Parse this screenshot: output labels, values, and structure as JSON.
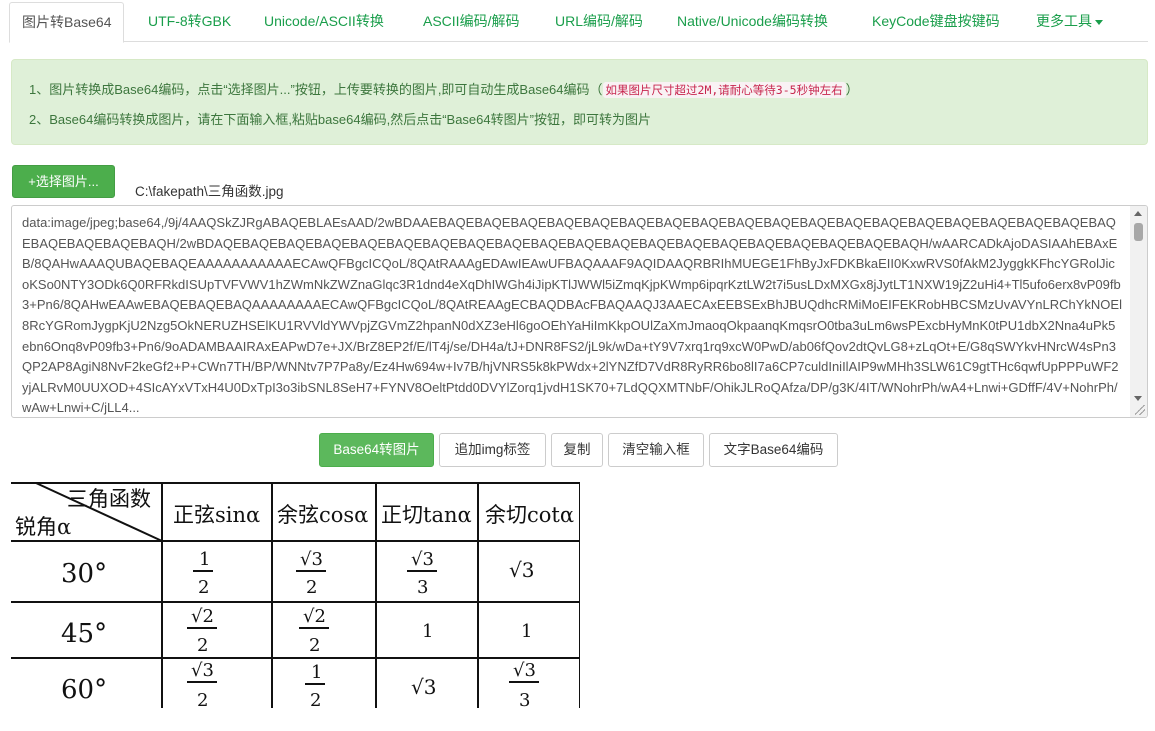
{
  "tabs": [
    {
      "label": "图片转Base64",
      "active": true
    },
    {
      "label": "UTF-8转GBK"
    },
    {
      "label": "Unicode/ASCII转换"
    },
    {
      "label": "ASCII编码/解码"
    },
    {
      "label": "URL编码/解码"
    },
    {
      "label": "Native/Unicode编码转换"
    },
    {
      "label": "KeyCode键盘按键码"
    },
    {
      "label": "更多工具"
    }
  ],
  "info": {
    "line1_main": "1、图片转换成Base64编码，点击“选择图片...”按钮，上传要转换的图片,即可自动生成Base64编码（",
    "line1_highlight": "如果图片尺寸超过2M,请耐心等待3-5秒钟左右",
    "line1_end": "）",
    "line2": "2、Base64编码转换成图片，请在下面输入框,粘贴base64编码,然后点击“Base64转图片”按钮，即可转为图片"
  },
  "select_button": "+选择图片...",
  "file_path": "C:\\fakepath\\三角函数.jpg",
  "textarea_value": "data:image/jpeg;base64,/9j/4AAQSkZJRgABAQEBLAEsAAD/2wBDAAEBAQEBAQEBAQEBAQEBAQEBAQEBAQEBAQEBAQEBAQEBAQEBAQEBAQEBAQEBAQEBAQEBAQEBAQEBAQEBAQEBAQEBAQEBAQH/2wBDAQEBAQEBAQEBAQEBAQEBAQEBAQEBAQEBAQEBAQEBAQEBAQEBAQEBAQEBAQEBAQEBAQEBAQEBAQEBAQH/wAARCADkAjoDASIAAhEBAxEB/8QAHwAAAQUBAQEBAQEAAAAAAAAAAAECAwQFBgcICQoL/8QAtRAAAgEDAwIEAwUFBAQAAAF9AQIDAAQRBRIhMUEGE1FhByJxFDKBkaEII0KxwRVS0fAkM2JyggkKFhcYGRolJicoKSo0NTY3ODk6Q0RFRkdISUpTVFVWV1hZWmNkZWZnaGlqc3R1dnd4eXqDhIWGh4iJipKTlJWWl5iZmqKjpKWmp6ipqrKztLW2t7i5usLDxMXGx8jJytLT1NXW19jZ2uHi4+Tl5ufo6erx8vP09fb3+Pn6/8QAHwEAAwEBAQEBAQEBAQAAAAAAAAECAwQFBgcICQoL/8QAtREAAgECBAQDBAcFBAQAAQJ3AAECAxEEBSExBhJBUQdhcRMiMoEIFEKRobHBCSMzUvAVYnLRChYkNOEl8RcYGRomJygpKjU2Nzg5OkNERUZHSElKU1RVVldYWVpjZGVmZ2hpanN0dXZ3eHl6goOEhYaHiImKkpOUlZaXmJmaoqOkpaanqKmqsrO0tba3uLm6wsPExcbHyMnK0tPU1dbX2Nna4uPk5ebn6Onq8vP09fb3+Pn6/9oADAMBAAIRAxEAPwD7e+JX/BrZ8EP2f/E/lT4j/se/DH4a/tJ+DNR8FS2/jL9k/wDa+tY9V7xrq1rq9xcW0PwD/ab06fQov2dtQvLG8+zLqOt+E/G8qSWYkvHNrcW4sPn3QP2AP8AgiN8NvF2keGf2+P+CWn7TH/BP/WNNtv7P7Pa8y/Ez4Hw694w+Iv7B/hjVNRS5k8kPWdx+2lYNZfD7VdR8RyRR6bo8lI7a6CP7culdIniIlAIP9wMHh3SLW61C9gtTHc6qwfUpPPPuWF2yjALRvM0UUXOD+4SIcAYxVTxH4U0DxTpI3o3ibSNL8SeH7+FYNV8OeltPtdd0DVYlZorq1jvdH1SK70+7LdQQXMTNbF/OhikJLRoQAfza/DP/g3K/4IT/WNohrPh/wA4+Lnwi+GDffF/4V+NohrPh/wAw+Lnwi+C/jLL4...",
  "buttons": {
    "base64_to_image": "Base64转图片",
    "add_img_tag": "追加img标签",
    "copy": "复制",
    "clear_input": "清空输入框",
    "text_base64": "文字Base64编码"
  },
  "result_table": {
    "header_corner_top": "三角函数",
    "header_corner_bottom": "锐角α",
    "headers": [
      "正弦sinα",
      "余弦cosα",
      "正切tanα",
      "余切cotα"
    ],
    "rows": [
      {
        "angle": "30°",
        "sin": "1/2",
        "cos": "√3/2",
        "tan": "√3/3",
        "cot": "√3"
      },
      {
        "angle": "45°",
        "sin": "√2/2",
        "cos": "√2/2",
        "tan": "1",
        "cot": "1"
      },
      {
        "angle": "60°",
        "sin": "√3/2",
        "cos": "1/2",
        "tan": "√3",
        "cot": "√3/3"
      }
    ]
  },
  "colors": {
    "tab_link": "#1a9e4b",
    "info_bg": "#dff0d8",
    "info_text": "#3c763d",
    "primary_button": "#5cb85c",
    "highlight_text": "#c7254e"
  }
}
